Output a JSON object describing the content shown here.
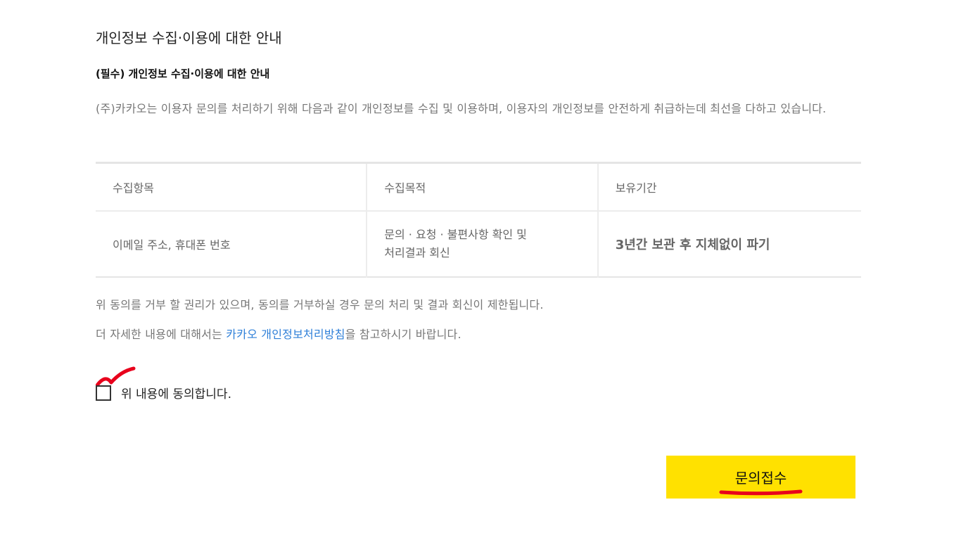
{
  "page": {
    "title": "개인정보 수집·이용에 대한 안내",
    "subtitle": "(필수) 개인정보 수집·이용에 대한 안내",
    "description": "(주)카카오는 이용자 문의를 처리하기 위해 다음과 같이 개인정보를 수집 및 이용하며, 이용자의 개인정보를 안전하게 취급하는데 최선을 다하고 있습니다."
  },
  "table": {
    "headers": [
      "수집항목",
      "수집목적",
      "보유기간"
    ],
    "row": {
      "items": "이메일 주소, 휴대폰 번호",
      "purpose_line1": "문의 · 요청 · 불편사항 확인 및",
      "purpose_line2": "처리결과 회신",
      "period": "3년간 보관 후 지체없이 파기"
    }
  },
  "notes": {
    "refuse": "위 동의를 거부 할 권리가 있으며, 동의를 거부하실 경우 문의 처리 및 결과 회신이 제한됩니다.",
    "more_prefix": "더 자세한 내용에 대해서는 ",
    "more_link": "카카오 개인정보처리방침",
    "more_suffix": "을 참고하시기 바랍니다."
  },
  "agree": {
    "label": "위 내용에 동의합니다."
  },
  "submit": {
    "label": "문의접수"
  },
  "colors": {
    "accent_button": "#ffe100",
    "link": "#2e7fd8",
    "annotation": "#e8001c"
  }
}
